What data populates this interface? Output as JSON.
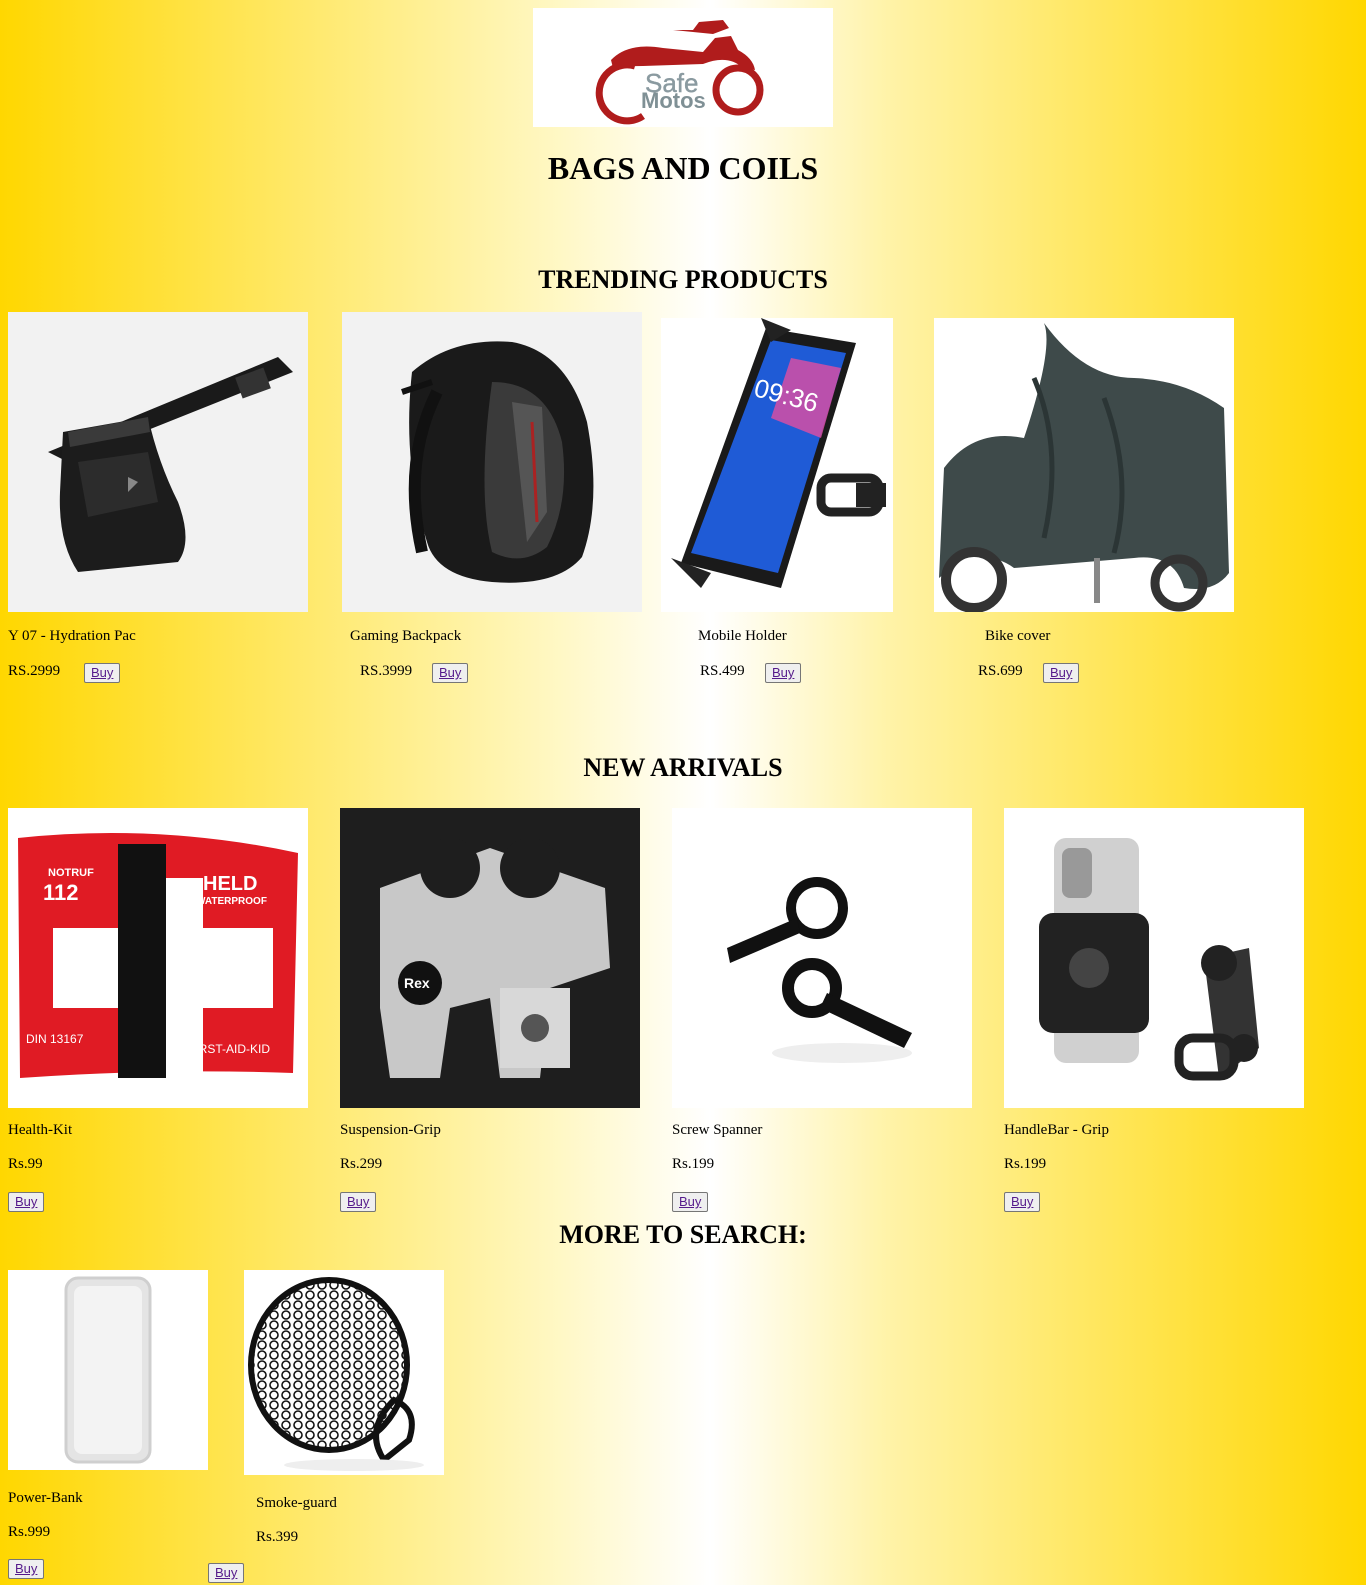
{
  "brand": {
    "logo_line1": "Safe",
    "logo_line2": "Motos",
    "accent": "#b01c1c"
  },
  "page_title": "BAGS AND COILS",
  "sections": {
    "trending": {
      "title": "TRENDING PRODUCTS",
      "items": [
        {
          "name": "Y 07 - Hydration Pac",
          "price": "RS.2999",
          "buy": "Buy",
          "icon": "hydration-pack-icon"
        },
        {
          "name": "Gaming Backpack",
          "price": "RS.3999",
          "buy": "Buy",
          "icon": "backpack-icon"
        },
        {
          "name": "Mobile Holder",
          "price": "RS.499",
          "buy": "Buy",
          "icon": "phone-holder-icon"
        },
        {
          "name": "Bike cover",
          "price": "RS.699",
          "buy": "Buy",
          "icon": "bike-cover-icon"
        }
      ]
    },
    "new_arrivals": {
      "title": "NEW ARRIVALS",
      "items": [
        {
          "name": "Health-Kit",
          "price": "Rs.99",
          "buy": "Buy",
          "icon": "first-aid-kit-icon",
          "image_text": [
            "NOTRUF",
            "112",
            "HELD",
            "WATERPROOF",
            "DIN 13167",
            "FIRST-AID-KID"
          ]
        },
        {
          "name": "Suspension-Grip",
          "price": "Rs.299",
          "buy": "Buy",
          "icon": "riser-clamp-icon",
          "image_text": [
            "Rex"
          ]
        },
        {
          "name": "Screw Spanner",
          "price": "Rs.199",
          "buy": "Buy",
          "icon": "clamp-icon"
        },
        {
          "name": "HandleBar - Grip",
          "price": "Rs.199",
          "buy": "Buy",
          "icon": "handlebar-mount-icon"
        }
      ]
    },
    "more": {
      "title": "MORE TO SEARCH:",
      "items": [
        {
          "name": "Power-Bank",
          "price": "Rs.999",
          "buy": "Buy",
          "icon": "phone-case-icon"
        },
        {
          "name": "Smoke-guard",
          "price": "Rs.399",
          "buy": "Buy",
          "icon": "headlight-guard-icon"
        }
      ]
    }
  }
}
